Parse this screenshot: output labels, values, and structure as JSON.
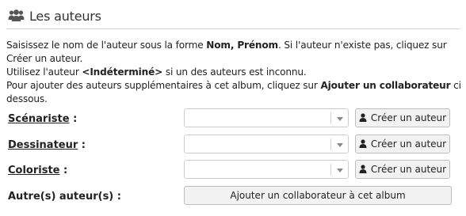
{
  "header": {
    "icon": "users-icon",
    "title": "Les auteurs"
  },
  "description": {
    "line1_pre": "Saisissez le nom de l'auteur sous la forme ",
    "line1_bold": "Nom, Prénom",
    "line1_post": ". Si l'auteur n'existe pas, cliquez sur Créer un auteur.",
    "line2_pre": "Utilisez l'auteur ",
    "line2_bold": "<Indéterminé>",
    "line2_post": " si un des auteurs est inconnu.",
    "line3_pre": "Pour ajouter des auteurs supplémentaires à cet album, cliquez sur ",
    "line3_bold": "Ajouter un collaborateur",
    "line3_post": " ci dessous."
  },
  "fields": [
    {
      "label": "Scénariste",
      "colon": " :",
      "value": "",
      "button": "Créer un auteur"
    },
    {
      "label": "Dessinateur",
      "colon": " :",
      "value": "",
      "button": "Créer un auteur"
    },
    {
      "label": "Coloriste",
      "colon": " :",
      "value": "",
      "button": "Créer un auteur"
    }
  ],
  "other_authors": {
    "label": "Autre(s) auteur(s) :",
    "button": "Ajouter un collaborateur à cet album"
  },
  "colors": {
    "button_bg": "#f2f2f2",
    "border": "#cccccc"
  }
}
